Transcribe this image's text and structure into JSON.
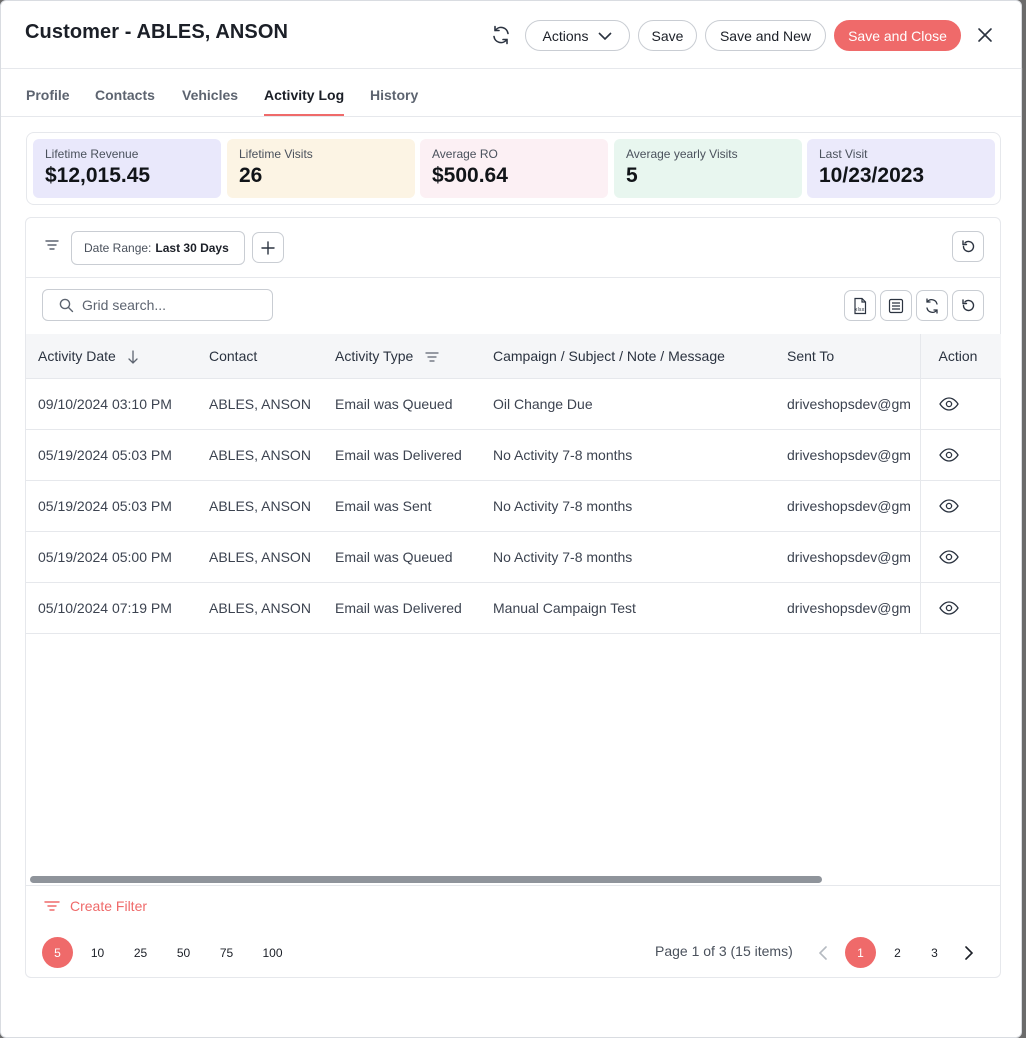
{
  "header": {
    "title": "Customer - ABLES, ANSON",
    "actions_label": "Actions",
    "save_label": "Save",
    "save_new_label": "Save and New",
    "save_close_label": "Save and Close"
  },
  "tabs": [
    {
      "label": "Profile"
    },
    {
      "label": "Contacts"
    },
    {
      "label": "Vehicles"
    },
    {
      "label": "Activity Log",
      "active": true
    },
    {
      "label": "History"
    }
  ],
  "stats": [
    {
      "label": "Lifetime Revenue",
      "value": "$12,015.45",
      "color": "#e9e8fb"
    },
    {
      "label": "Lifetime Visits",
      "value": "26",
      "color": "#fcf4e4"
    },
    {
      "label": "Average RO",
      "value": "$500.64",
      "color": "#fcf0f4"
    },
    {
      "label": "Average yearly Visits",
      "value": "5",
      "color": "#e8f6ef"
    },
    {
      "label": "Last Visit",
      "value": "10/23/2023",
      "color": "#ebeafb"
    }
  ],
  "filter": {
    "chip_label": "Date Range:",
    "chip_value": "Last 30 Days"
  },
  "search": {
    "placeholder": "Grid search..."
  },
  "table": {
    "columns": [
      "Activity Date",
      "Contact",
      "Activity Type",
      "Campaign / Subject / Note / Message",
      "Sent To",
      "Action"
    ],
    "rows": [
      [
        "09/10/2024 03:10 PM",
        "ABLES, ANSON",
        "Email was Queued",
        "Oil Change Due",
        "driveshopsdev@gm"
      ],
      [
        "05/19/2024 05:03 PM",
        "ABLES, ANSON",
        "Email was Delivered",
        "No Activity 7-8 months",
        "driveshopsdev@gm"
      ],
      [
        "05/19/2024 05:03 PM",
        "ABLES, ANSON",
        "Email was Sent",
        "No Activity 7-8 months",
        "driveshopsdev@gm"
      ],
      [
        "05/19/2024 05:00 PM",
        "ABLES, ANSON",
        "Email was Queued",
        "No Activity 7-8 months",
        "driveshopsdev@gm"
      ],
      [
        "05/10/2024 07:19 PM",
        "ABLES, ANSON",
        "Email was Delivered",
        "Manual Campaign Test",
        "driveshopsdev@gm"
      ]
    ]
  },
  "footer": {
    "create_filter_label": "Create Filter",
    "page_sizes": [
      "5",
      "10",
      "25",
      "50",
      "75",
      "100"
    ],
    "active_page_size": "5",
    "page_info": "Page 1 of 3 (15 items)",
    "pages": [
      "1",
      "2",
      "3"
    ],
    "active_page": "1"
  },
  "colors": {
    "accent": "#ef6a6a"
  }
}
